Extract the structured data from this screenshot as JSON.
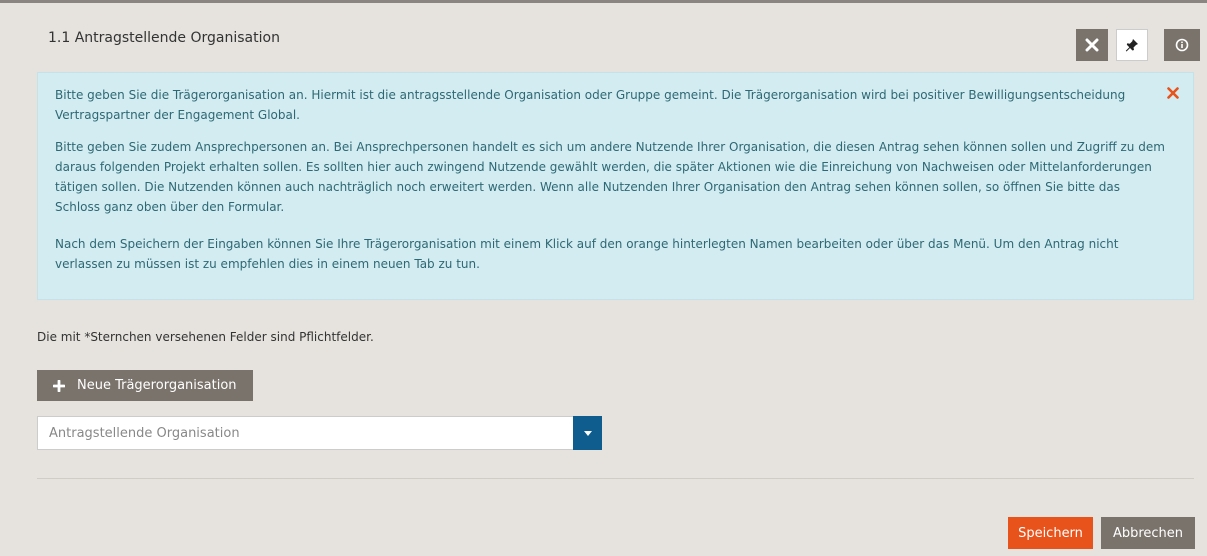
{
  "panel": {
    "title": "1.1 Antragstellende Organisation",
    "icons": [
      "close-icon",
      "pin-icon",
      "info-icon"
    ]
  },
  "info": {
    "paragraph1": "Bitte geben Sie die Trägerorganisation an. Hiermit ist die antragsstellende Organisation oder Gruppe gemeint. Die Trägerorganisation wird bei positiver Bewilligungsentscheidung Vertragspartner der Engagement Global.",
    "paragraph2": "Bitte geben Sie zudem Ansprechpersonen an. Bei Ansprechpersonen handelt es sich um andere Nutzende Ihrer Organisation, die diesen Antrag sehen können sollen und Zugriff zu dem daraus folgenden Projekt erhalten sollen. Es sollten hier auch zwingend Nutzende gewählt werden, die später Aktionen wie die Einreichung von Nachweisen oder Mittelanforderungen tätigen sollen. Die Nutzenden können auch nachträglich noch erweitert werden. Wenn alle Nutzenden Ihrer Organisation den Antrag sehen können sollen, so öffnen Sie bitte das Schloss ganz oben über den Formular.",
    "paragraph3": "Nach dem Speichern der Eingaben können Sie Ihre Trägerorganisation mit einem Klick auf den orange hinterlegten Namen bearbeiten oder über das Menü. Um den Antrag nicht verlassen zu müssen ist zu empfehlen dies in einem neuen Tab zu tun.",
    "close_color": "#e8531c"
  },
  "form": {
    "required_note": "Die mit *Sternchen versehenen Felder sind Pflichtfelder.",
    "new_org_label": "Neue Trägerorganisation",
    "select_placeholder": "Antragstellende Organisation"
  },
  "actions": {
    "save_label": "Speichern",
    "cancel_label": "Abbrechen"
  },
  "colors": {
    "accent": "#e8531c",
    "dark_button": "#7a736c",
    "select_caret": "#0f5d8e",
    "info_bg": "#d2ecf1",
    "info_text": "#2e6874"
  }
}
